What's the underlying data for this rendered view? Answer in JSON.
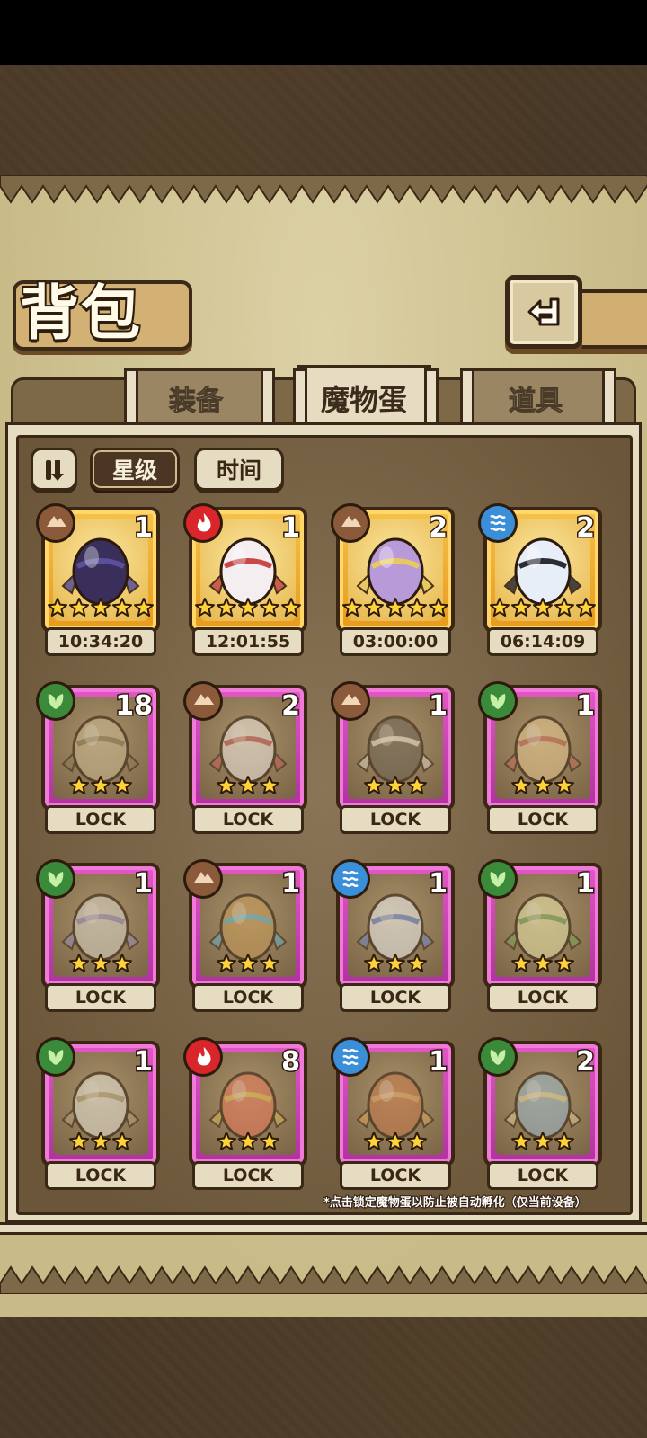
{
  "title": "背包",
  "tabs": [
    {
      "label": "装备",
      "active": false
    },
    {
      "label": "魔物蛋",
      "active": true
    },
    {
      "label": "道具",
      "active": false
    }
  ],
  "sort": {
    "star_label": "星级",
    "time_label": "时间",
    "active": "star"
  },
  "eggs": [
    {
      "element": "earth",
      "count": "1",
      "stars": 5,
      "footer": "10:34:20",
      "rarity": "gold",
      "art": "dark-crystal-egg"
    },
    {
      "element": "fire",
      "count": "1",
      "stars": 5,
      "footer": "12:01:55",
      "rarity": "gold",
      "art": "white-flame-egg"
    },
    {
      "element": "earth",
      "count": "2",
      "stars": 5,
      "footer": "03:00:00",
      "rarity": "gold",
      "art": "butterfly-crown-egg"
    },
    {
      "element": "water",
      "count": "2",
      "stars": 5,
      "footer": "06:14:09",
      "rarity": "gold",
      "art": "armored-orb-egg"
    },
    {
      "element": "leaf",
      "count": "18",
      "stars": 3,
      "footer": "LOCK",
      "rarity": "purple",
      "art": "striped-leaf-egg"
    },
    {
      "element": "earth",
      "count": "2",
      "stars": 3,
      "footer": "LOCK",
      "rarity": "purple",
      "art": "cracked-skull-egg"
    },
    {
      "element": "earth",
      "count": "1",
      "stars": 3,
      "footer": "LOCK",
      "rarity": "purple",
      "art": "beetle-egg"
    },
    {
      "element": "leaf",
      "count": "1",
      "stars": 3,
      "footer": "LOCK",
      "rarity": "purple",
      "art": "feathered-egg"
    },
    {
      "element": "leaf",
      "count": "1",
      "stars": 3,
      "footer": "LOCK",
      "rarity": "purple",
      "art": "moon-ring-egg"
    },
    {
      "element": "earth",
      "count": "1",
      "stars": 3,
      "footer": "LOCK",
      "rarity": "purple",
      "art": "furry-gem-egg"
    },
    {
      "element": "water",
      "count": "1",
      "stars": 3,
      "footer": "LOCK",
      "rarity": "purple",
      "art": "flower-egg"
    },
    {
      "element": "leaf",
      "count": "1",
      "stars": 3,
      "footer": "LOCK",
      "rarity": "purple",
      "art": "leaf-fruit-egg"
    },
    {
      "element": "leaf",
      "count": "1",
      "stars": 3,
      "footer": "LOCK",
      "rarity": "purple",
      "art": "winged-helmet-egg"
    },
    {
      "element": "fire",
      "count": "8",
      "stars": 3,
      "footer": "LOCK",
      "rarity": "purple",
      "art": "crowned-jar-egg"
    },
    {
      "element": "water",
      "count": "1",
      "stars": 3,
      "footer": "LOCK",
      "rarity": "purple",
      "art": "carrot-feather-egg"
    },
    {
      "element": "leaf",
      "count": "2",
      "stars": 3,
      "footer": "LOCK",
      "rarity": "purple",
      "art": "blade-egg"
    }
  ],
  "note": "*点击锁定魔物蛋以防止被自动孵化（仅当前设备）",
  "colors": {
    "gold_frame": "#f6c24a",
    "purple_frame": "#e456c8",
    "earth": "#8a5a3a",
    "fire": "#d8262a",
    "water": "#3b8ed8",
    "leaf": "#3a8a3a",
    "parchment": "#cfc196",
    "outline": "#3a2816"
  },
  "icons": {
    "back": "return-arrow-icon",
    "sort_toggle": "sort-order-icon",
    "star": "star-icon"
  }
}
